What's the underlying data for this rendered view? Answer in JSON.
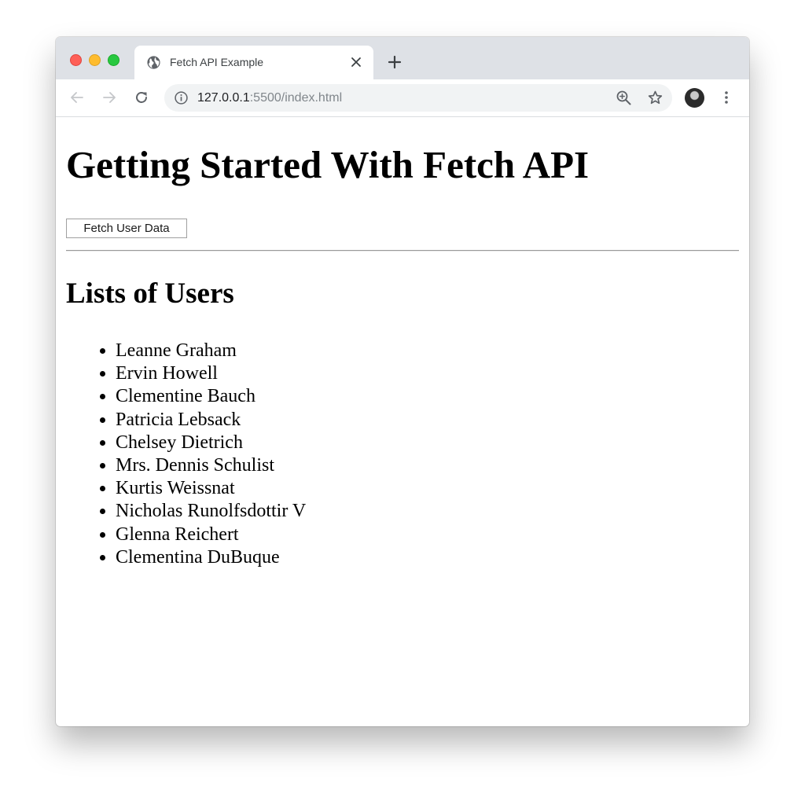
{
  "browser": {
    "tab_title": "Fetch API Example",
    "url_host": "127.0.0.1",
    "url_rest": ":5500/index.html"
  },
  "page": {
    "heading": "Getting Started With Fetch API",
    "fetch_button_label": "Fetch User Data",
    "list_heading": "Lists of Users",
    "users": [
      "Leanne Graham",
      "Ervin Howell",
      "Clementine Bauch",
      "Patricia Lebsack",
      "Chelsey Dietrich",
      "Mrs. Dennis Schulist",
      "Kurtis Weissnat",
      "Nicholas Runolfsdottir V",
      "Glenna Reichert",
      "Clementina DuBuque"
    ]
  },
  "colors": {
    "close_red": "#fe5f57",
    "minimize_yellow": "#febc2e",
    "zoom_green": "#28c840",
    "tabstrip_bg": "#dee1e6",
    "omnibox_bg": "#f1f3f4"
  },
  "icons": [
    "globe-icon",
    "close-icon",
    "plus-icon",
    "back-arrow-icon",
    "forward-arrow-icon",
    "reload-icon",
    "info-icon",
    "zoom-icon",
    "star-icon",
    "more-vert-icon"
  ]
}
